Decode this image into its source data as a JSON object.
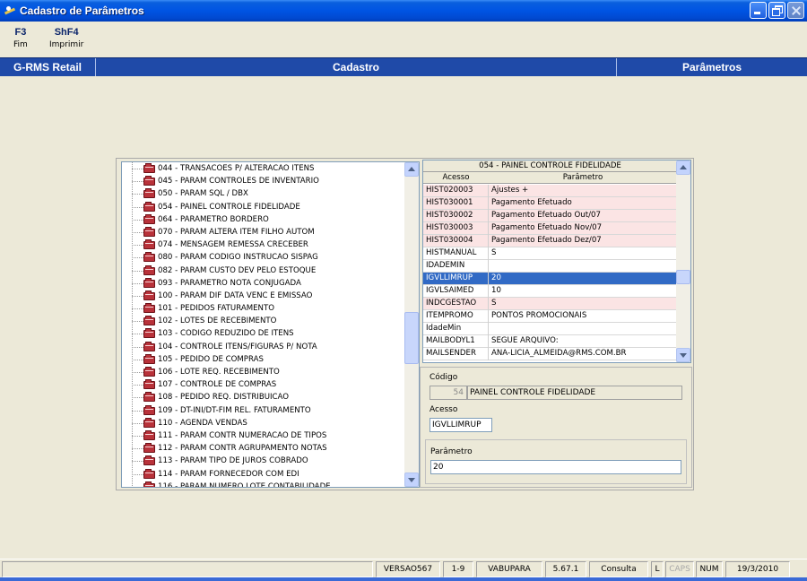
{
  "window": {
    "title": "Cadastro de Parâmetros",
    "icon": "app-icon"
  },
  "toolbar": {
    "buttons": [
      {
        "key": "F3",
        "label": "Fim"
      },
      {
        "key": "ShF4",
        "label": "Imprimir"
      }
    ]
  },
  "header": {
    "left": "G-RMS Retail",
    "center": "Cadastro",
    "right": "Parâmetros"
  },
  "tree": {
    "items": [
      "044 - TRANSACOES P/ ALTERACAO ITENS",
      "045 - PARAM CONTROLES DE INVENTARIO",
      "050 - PARAM SQL / DBX",
      "054 - PAINEL CONTROLE FIDELIDADE",
      "064 - PARAMETRO BORDERO",
      "070 - PARAM ALTERA ITEM FILHO AUTOM",
      "074 - MENSAGEM REMESSA CRECEBER",
      "080 - PARAM CODIGO INSTRUCAO SISPAG",
      "082 - PARAM CUSTO DEV PELO ESTOQUE",
      "093 - PARAMETRO NOTA CONJUGADA",
      "100 - PARAM DIF DATA VENC E EMISSAO",
      "101 - PEDIDOS FATURAMENTO",
      "102 - LOTES DE RECEBIMENTO",
      "103 - CODIGO REDUZIDO DE ITENS",
      "104 - CONTROLE ITENS/FIGURAS P/ NOTA",
      "105 - PEDIDO DE COMPRAS",
      "106 - LOTE REQ. RECEBIMENTO",
      "107 - CONTROLE DE COMPRAS",
      "108 - PEDIDO REQ. DISTRIBUICAO",
      "109 - DT-INI/DT-FIM REL. FATURAMENTO",
      "110 - AGENDA VENDAS",
      "111 - PARAM CONTR NUMERACAO DE TIPOS",
      "112 - PARAM CONTR AGRUPAMENTO NOTAS",
      "113 - PARAM TIPO DE JUROS COBRADO",
      "114 - PARAM FORNECEDOR COM EDI",
      "116 - PARAM NUMERO LOTE CONTABILIDADE"
    ],
    "scroll_position": 0.55
  },
  "grid": {
    "title": "054 - PAINEL CONTROLE FIDELIDADE",
    "columns": [
      "Acesso",
      "Parâmetro"
    ],
    "rows": [
      {
        "acesso": "HIST020003",
        "parametro": "Ajustes +",
        "style": "pink"
      },
      {
        "acesso": "HIST030001",
        "parametro": "Pagamento Efetuado",
        "style": "pink"
      },
      {
        "acesso": "HIST030002",
        "parametro": "Pagamento Efetuado Out/07",
        "style": "pink"
      },
      {
        "acesso": "HIST030003",
        "parametro": "Pagamento Efetuado Nov/07",
        "style": "pink"
      },
      {
        "acesso": "HIST030004",
        "parametro": "Pagamento Efetuado Dez/07",
        "style": "pink"
      },
      {
        "acesso": "HISTMANUAL",
        "parametro": "S",
        "style": "white"
      },
      {
        "acesso": "IDADEMIN",
        "parametro": "",
        "style": "white"
      },
      {
        "acesso": "IGVLLIMRUP",
        "parametro": "20",
        "style": "selected"
      },
      {
        "acesso": "IGVLSAIMED",
        "parametro": "10",
        "style": "white"
      },
      {
        "acesso": "INDCGESTAO",
        "parametro": "S",
        "style": "pink"
      },
      {
        "acesso": "ITEMPROMO",
        "parametro": "PONTOS PROMOCIONAIS",
        "style": "white"
      },
      {
        "acesso": "IdadeMin",
        "parametro": "",
        "style": "white"
      },
      {
        "acesso": "MAILBODYL1",
        "parametro": "SEGUE ARQUIVO:",
        "style": "white"
      },
      {
        "acesso": "MAILSENDER",
        "parametro": "ANA-LICIA_ALMEIDA@RMS.COM.BR",
        "style": "white"
      }
    ],
    "scroll_position": 0.6
  },
  "detail": {
    "codigo_label": "Código",
    "codigo_value": "54",
    "codigo_desc": "PAINEL CONTROLE FIDELIDADE",
    "acesso_label": "Acesso",
    "acesso_value": "IGVLLIMRUP",
    "parametro_label": "Parâmetro",
    "parametro_value": "20"
  },
  "status": {
    "version": "VERSAO567",
    "range": "1-9",
    "store": "VABUPARA",
    "build": "5.67.1",
    "mode": "Consulta",
    "l": "L",
    "caps": "CAPS",
    "num": "NUM",
    "date": "19/3/2010"
  },
  "colors": {
    "titlebar": "#0054e3",
    "header_band": "#1f4aa8",
    "row_pink": "#fbe4e4",
    "row_selected": "#316ac5"
  }
}
